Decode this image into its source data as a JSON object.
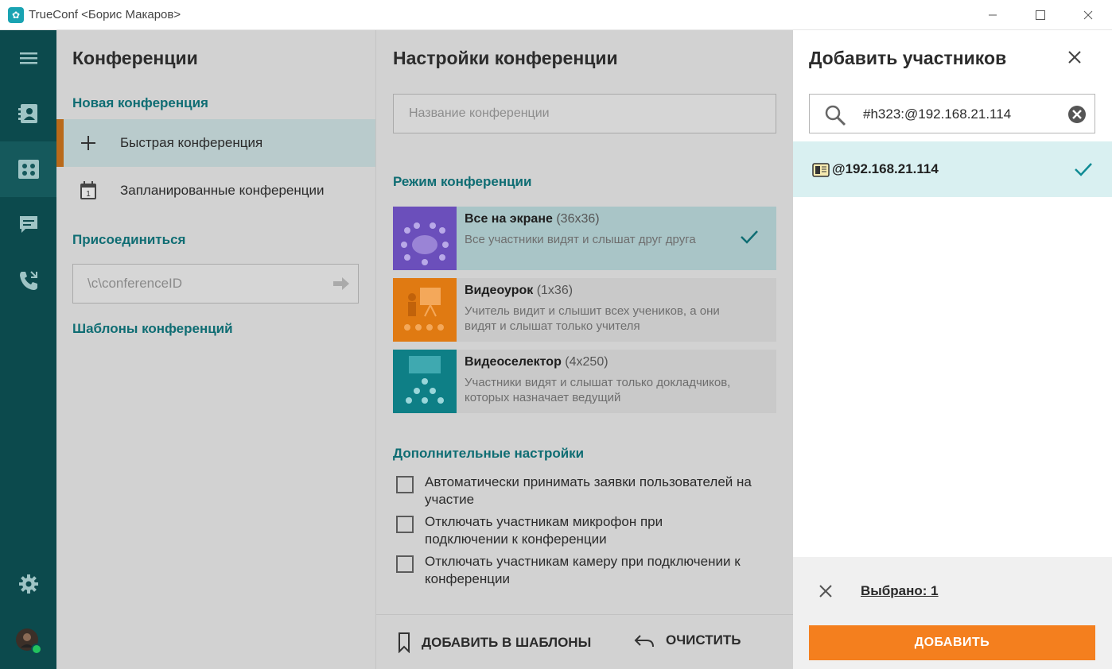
{
  "window": {
    "title": "TrueConf <Борис Макаров>"
  },
  "conferences": {
    "title": "Конференции",
    "new_conference": "Новая конференция",
    "items": [
      {
        "label": "Быстрая конференция",
        "icon": "plus-icon"
      },
      {
        "label": "Запланированные конференции",
        "icon": "calendar-icon"
      }
    ],
    "join_label": "Присоединиться",
    "join_placeholder": "\\c\\conferenceID",
    "templates_label": "Шаблоны конференций"
  },
  "settings": {
    "title": "Настройки конференции",
    "name_placeholder": "Название конференции",
    "mode_label": "Режим конференции",
    "modes": [
      {
        "title": "Все на экране",
        "capacity": "(36x36)",
        "desc": "Все участники видят и слышат друг друга",
        "selected": true,
        "color": "#6b4fbb"
      },
      {
        "title": "Видеоурок",
        "capacity": "(1x36)",
        "desc": "Учитель видит и слышит всех учеников, а они видят и слышат только учителя",
        "selected": false,
        "color": "#e07a12"
      },
      {
        "title": "Видеоселектор",
        "capacity": "(4x250)",
        "desc": "Участники видят и слышат только докладчиков, которых назначает ведущий",
        "selected": false,
        "color": "#0e7f86"
      }
    ],
    "extra_label": "Дополнительные настройки",
    "options": [
      {
        "label": "Автоматически принимать заявки пользователей на участие",
        "checked": false
      },
      {
        "label": "Отключать участникам микрофон при подключении к конференции",
        "checked": false
      },
      {
        "label": "Отключать участникам камеру при подключении к конференции",
        "checked": false
      }
    ],
    "add_to_templates": "ДОБАВИТЬ В ШАБЛОНЫ",
    "clear": "ОЧИСТИТЬ"
  },
  "add_participants": {
    "title": "Добавить участников",
    "search_value": "#h323:@192.168.21.114",
    "result": "@192.168.21.114",
    "selected_text": "Выбрано: 1",
    "add_button": "ДОБАВИТЬ"
  },
  "colors": {
    "rail": "#0c4a4d",
    "accent_teal": "#0f6d73",
    "accent_orange": "#f47f1e"
  }
}
